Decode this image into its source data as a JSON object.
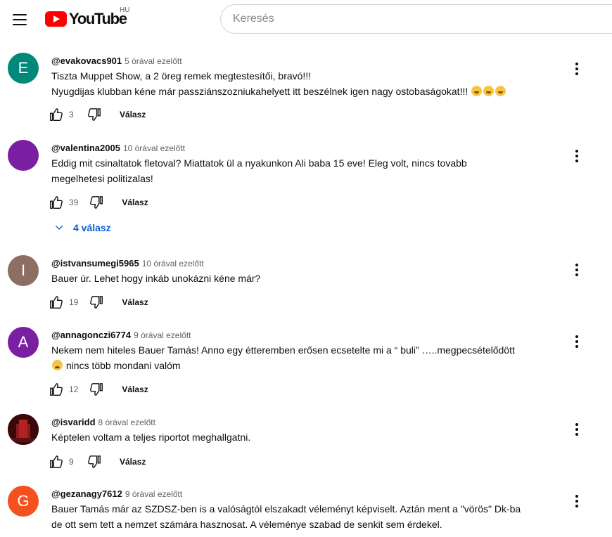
{
  "header": {
    "logo_text": "YouTube",
    "region": "HU",
    "search_placeholder": "Keresés"
  },
  "colors": {
    "brand_red": "#ff0000",
    "link_blue": "#065fd4"
  },
  "comments": [
    {
      "avatar_letter": "E",
      "avatar_color": "#00897b",
      "author": "@evakovacs901",
      "time": "5 órával ezelőtt",
      "lines": [
        "Tiszta Muppet Show, a 2 öreg remek megtestesítői, bravó!!!",
        "Nyugdijas klubban kéne már passziánszozniukahelyett itt beszélnek igen nagy ostobaságokat!!!"
      ],
      "emoji_suffix": "laughing-emoji x3",
      "likes": "3",
      "reply_label": "Válasz"
    },
    {
      "avatar_letter": "",
      "avatar_color": "#7b1fa2",
      "author": "@valentina2005",
      "time": "10 órával ezelőtt",
      "lines": [
        "Eddig mit csinaltatok fletoval? Miattatok ül a nyakunkon Ali baba 15 eve! Eleg volt, nincs tovabb",
        "megelhetesi politizalas!"
      ],
      "likes": "39",
      "reply_label": "Válasz",
      "replies_label": "4 válasz"
    },
    {
      "avatar_letter": "I",
      "avatar_color": "#8d6e63",
      "author": "@istvansumegi5965",
      "time": "10 órával ezelőtt",
      "lines": [
        "Bauer úr. Lehet hogy inkáb unokázni kéne már?"
      ],
      "likes": "19",
      "reply_label": "Válasz"
    },
    {
      "avatar_letter": "A",
      "avatar_color": "#7b1fa2",
      "author": "@annagonczi6774",
      "time": "9 órával ezelőtt",
      "lines": [
        "Nekem nem hiteles Bauer Tamás! Anno egy étteremben erősen ecsetelte mi a “ buli” …..megpecsételődött",
        "nincs több mondani valóm"
      ],
      "emoji_prefix_line2": "sad-emoji",
      "likes": "12",
      "reply_label": "Válasz"
    },
    {
      "avatar_letter": "",
      "avatar_color": "#2b0a0a",
      "author": "@isvaridd",
      "time": "8 órával ezelőtt",
      "lines": [
        "Képtelen voltam a teljes riportot meghallgatni."
      ],
      "likes": "9",
      "reply_label": "Válasz"
    },
    {
      "avatar_letter": "G",
      "avatar_color": "#f4511e",
      "author": "@gezanagy7612",
      "time": "9 órával ezelőtt",
      "lines": [
        "Bauer Tamás már az SZDSZ-ben is  a valóságtól elszakadt véleményt képviselt. Aztán ment a \"vörös\" Dk-ba",
        "de ott sem tett a nemzet számára hasznosat. A véleménye szabad de senkit sem érdekel."
      ]
    }
  ]
}
